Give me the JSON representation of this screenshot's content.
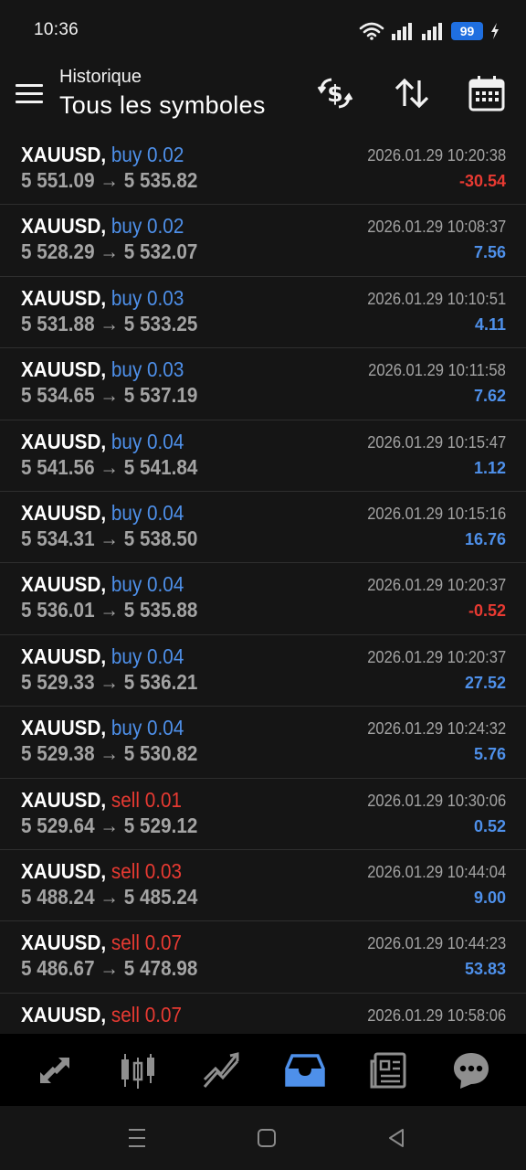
{
  "status_bar": {
    "time": "10:36",
    "battery": "99"
  },
  "header": {
    "subtitle": "Historique",
    "title": "Tous les symboles"
  },
  "colors": {
    "buy": "#4e90ea",
    "sell": "#e83a32",
    "profit_positive": "#4e90ea",
    "profit_negative": "#e83a32",
    "active_tab": "#4e90ea"
  },
  "icons": [
    "menu-icon",
    "currency-exchange-icon",
    "sort-icon",
    "calendar-icon",
    "trade-icon",
    "chart-icon",
    "analytics-icon",
    "history-icon",
    "news-icon",
    "chat-icon"
  ],
  "trades": [
    {
      "symbol": "XAUUSD,",
      "side": "buy 0.02",
      "type": "buy",
      "open": "5 551.09",
      "close": "5 535.82",
      "time": "2026.01.29 10:20:38",
      "profit": "-30.54"
    },
    {
      "symbol": "XAUUSD,",
      "side": "buy 0.02",
      "type": "buy",
      "open": "5 528.29",
      "close": "5 532.07",
      "time": "2026.01.29 10:08:37",
      "profit": "7.56"
    },
    {
      "symbol": "XAUUSD,",
      "side": "buy 0.03",
      "type": "buy",
      "open": "5 531.88",
      "close": "5 533.25",
      "time": "2026.01.29 10:10:51",
      "profit": "4.11"
    },
    {
      "symbol": "XAUUSD,",
      "side": "buy 0.03",
      "type": "buy",
      "open": "5 534.65",
      "close": "5 537.19",
      "time": "2026.01.29 10:11:58",
      "profit": "7.62"
    },
    {
      "symbol": "XAUUSD,",
      "side": "buy 0.04",
      "type": "buy",
      "open": "5 541.56",
      "close": "5 541.84",
      "time": "2026.01.29 10:15:47",
      "profit": "1.12"
    },
    {
      "symbol": "XAUUSD,",
      "side": "buy 0.04",
      "type": "buy",
      "open": "5 534.31",
      "close": "5 538.50",
      "time": "2026.01.29 10:15:16",
      "profit": "16.76"
    },
    {
      "symbol": "XAUUSD,",
      "side": "buy 0.04",
      "type": "buy",
      "open": "5 536.01",
      "close": "5 535.88",
      "time": "2026.01.29 10:20:37",
      "profit": "-0.52"
    },
    {
      "symbol": "XAUUSD,",
      "side": "buy 0.04",
      "type": "buy",
      "open": "5 529.33",
      "close": "5 536.21",
      "time": "2026.01.29 10:20:37",
      "profit": "27.52"
    },
    {
      "symbol": "XAUUSD,",
      "side": "buy 0.04",
      "type": "buy",
      "open": "5 529.38",
      "close": "5 530.82",
      "time": "2026.01.29 10:24:32",
      "profit": "5.76"
    },
    {
      "symbol": "XAUUSD,",
      "side": "sell 0.01",
      "type": "sell",
      "open": "5 529.64",
      "close": "5 529.12",
      "time": "2026.01.29 10:30:06",
      "profit": "0.52"
    },
    {
      "symbol": "XAUUSD,",
      "side": "sell 0.03",
      "type": "sell",
      "open": "5 488.24",
      "close": "5 485.24",
      "time": "2026.01.29 10:44:04",
      "profit": "9.00"
    },
    {
      "symbol": "XAUUSD,",
      "side": "sell 0.07",
      "type": "sell",
      "open": "5 486.67",
      "close": "5 478.98",
      "time": "2026.01.29 10:44:23",
      "profit": "53.83"
    },
    {
      "symbol": "XAUUSD,",
      "side": "sell 0.07",
      "type": "sell",
      "open": "",
      "close": "",
      "time": "2026.01.29 10:58:06",
      "profit": ""
    }
  ],
  "bottom_nav": {
    "active": "history"
  }
}
